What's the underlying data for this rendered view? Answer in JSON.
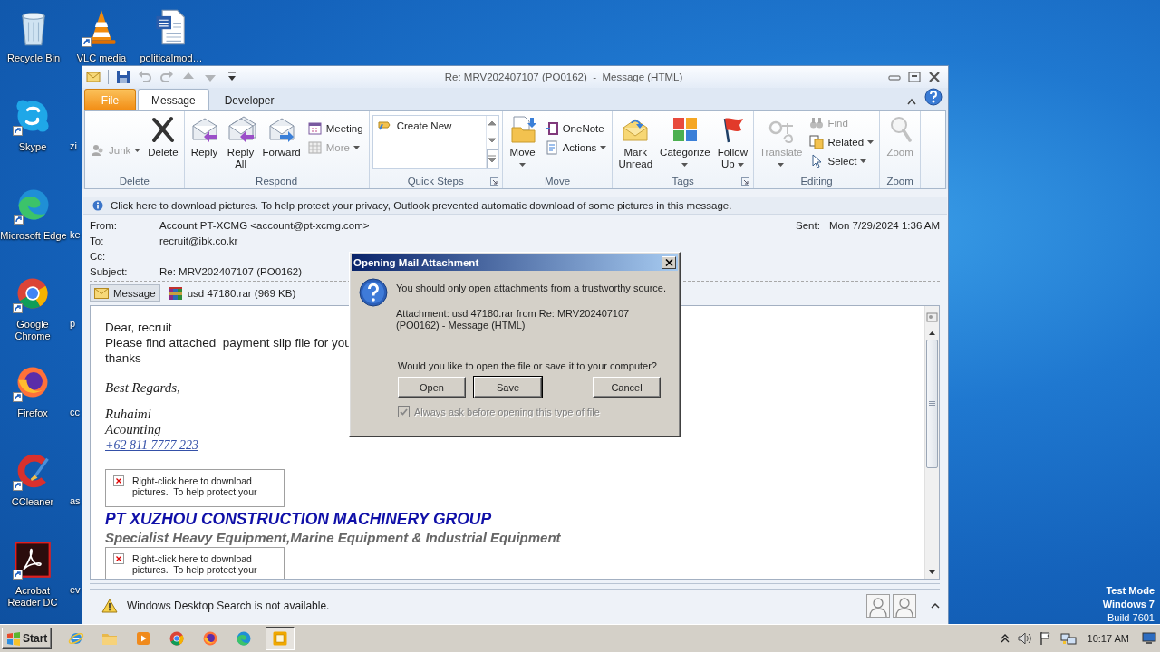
{
  "desktop": {
    "icons": [
      {
        "label": "Recycle Bin",
        "shortcut": false
      },
      {
        "label": "VLC media",
        "shortcut": true
      },
      {
        "label": "politicalmod…",
        "shortcut": false
      },
      {
        "label": "Skype",
        "shortcut": true
      },
      {
        "label": "Microsoft Edge",
        "shortcut": true
      },
      {
        "label": "Google Chrome",
        "shortcut": true
      },
      {
        "label": "Firefox",
        "shortcut": true
      },
      {
        "label": "CCleaner",
        "shortcut": true
      },
      {
        "label": "Acrobat Reader DC",
        "shortcut": true
      }
    ],
    "partial_labels": [
      "zi",
      "ke",
      "p",
      "cc",
      "as",
      "ev"
    ],
    "os_notice": [
      "Test Mode",
      "Windows 7",
      "Build 7601"
    ]
  },
  "window": {
    "title": "Re: MRV202407107 (PO0162)  -  Message (HTML)",
    "quick_access": [
      {
        "disabled": false
      },
      {
        "disabled": true
      },
      {
        "disabled": true
      },
      {
        "disabled": true
      },
      {
        "disabled": true
      },
      {
        "disabled": false
      }
    ],
    "tabs": [
      {
        "label": "File",
        "kind": "backstage",
        "selected": false
      },
      {
        "label": "Message",
        "kind": "tab",
        "selected": true
      },
      {
        "label": "Developer",
        "kind": "tab",
        "selected": false
      }
    ],
    "ribbon": [
      {
        "label": "Delete",
        "launcher": false,
        "items": [
          {
            "kind": "small",
            "label": "Junk",
            "disabled": true,
            "dropdown": true
          },
          {
            "kind": "large",
            "label": "Delete",
            "disabled": false,
            "dropdown": false
          }
        ]
      },
      {
        "label": "Respond",
        "launcher": false,
        "items": [
          {
            "kind": "large",
            "label": "Reply",
            "disabled": false,
            "dropdown": false
          },
          {
            "kind": "large",
            "label": "Reply All",
            "disabled": false,
            "dropdown": false
          },
          {
            "kind": "large",
            "label": "Forward",
            "disabled": false,
            "dropdown": false
          },
          {
            "kind": "small",
            "label": "Meeting",
            "disabled": false,
            "dropdown": false
          },
          {
            "kind": "small",
            "label": "More",
            "disabled": true,
            "dropdown": true
          }
        ]
      },
      {
        "label": "Quick Steps",
        "launcher": true,
        "items": [
          {
            "kind": "gallery",
            "entries": [
              "Create New"
            ]
          }
        ]
      },
      {
        "label": "Move",
        "launcher": false,
        "items": [
          {
            "kind": "large",
            "label": "Move",
            "disabled": false,
            "dropdown": true
          },
          {
            "kind": "small",
            "label": "OneNote",
            "disabled": false,
            "dropdown": false
          },
          {
            "kind": "small",
            "label": "Actions",
            "disabled": false,
            "dropdown": true
          }
        ]
      },
      {
        "label": "Tags",
        "launcher": true,
        "items": [
          {
            "kind": "large",
            "label": "Mark Unread",
            "disabled": false,
            "dropdown": false
          },
          {
            "kind": "large",
            "label": "Categorize",
            "disabled": false,
            "dropdown": true
          },
          {
            "kind": "large",
            "label": "Follow Up",
            "disabled": false,
            "dropdown": true
          }
        ]
      },
      {
        "label": "Editing",
        "launcher": false,
        "items": [
          {
            "kind": "large",
            "label": "Translate",
            "disabled": true,
            "dropdown": true
          },
          {
            "kind": "small",
            "label": "Find",
            "disabled": true,
            "dropdown": false
          },
          {
            "kind": "small",
            "label": "Related",
            "disabled": false,
            "dropdown": true
          },
          {
            "kind": "small",
            "label": "Select",
            "disabled": false,
            "dropdown": true
          }
        ]
      },
      {
        "label": "Zoom",
        "launcher": false,
        "items": [
          {
            "kind": "large",
            "label": "Zoom",
            "disabled": true,
            "dropdown": false
          }
        ]
      }
    ],
    "infobar": "Click here to download pictures. To help protect your privacy, Outlook prevented automatic download of some pictures in this message.",
    "header": {
      "fields": [
        {
          "label": "From:",
          "value": "Account PT-XCMG <account@pt-xcmg.com>"
        },
        {
          "label": "To:",
          "value": "recruit@ibk.co.kr"
        },
        {
          "label": "Cc:"
        },
        {
          "label": "Subject:",
          "value": "Re: MRV202407107 (PO0162)"
        }
      ],
      "sent": {
        "label": "Sent:",
        "value": "Mon 7/29/2024 1:36 AM"
      }
    },
    "attachments": [
      {
        "label": "Message",
        "kind": "message",
        "selected": true
      },
      {
        "label": "usd 47180.rar (969 KB)",
        "kind": "file",
        "selected": false
      }
    ],
    "body": [
      {
        "kind": "plain",
        "text": "Dear, recruit"
      },
      {
        "kind": "plain",
        "text": "Please find attached  payment slip file for you"
      },
      {
        "kind": "plain",
        "text": "thanks"
      },
      {
        "kind": "gap"
      },
      {
        "kind": "signature",
        "text": "Best Regards,"
      },
      {
        "kind": "gap"
      },
      {
        "kind": "signature",
        "text": "Ruhaimi"
      },
      {
        "kind": "signature",
        "text": "Acounting"
      },
      {
        "kind": "link",
        "text": "+62 811  7777 223"
      },
      {
        "kind": "gap"
      },
      {
        "kind": "blocked_image",
        "text": "Right-click here to download pictures.  To help protect your"
      },
      {
        "kind": "company",
        "text": "PT XUZHOU CONSTRUCTION MACHINERY GROUP"
      },
      {
        "kind": "tagline",
        "text": "Specialist Heavy Equipment,Marine Equipment & Industrial Equipment"
      },
      {
        "kind": "blocked_image",
        "text": "Right-click here to download pictures.  To help protect your"
      }
    ],
    "status": "Windows Desktop Search is not available."
  },
  "dialog": {
    "title": "Opening Mail Attachment",
    "message": "You should only open attachments from a trustworthy source.",
    "detail": "Attachment: usd 47180.rar from Re: MRV202407107 (PO0162) - Message (HTML)",
    "question": "Would you like to open the file or save it to your computer?",
    "buttons": [
      {
        "label": "Open",
        "default": false
      },
      {
        "label": "Save",
        "default": true
      },
      {
        "label": "Cancel",
        "default": false
      }
    ],
    "checkbox": {
      "label": "Always ask before opening this type of file",
      "checked": true,
      "disabled": true
    }
  },
  "taskbar": {
    "start": "Start",
    "apps": [
      {
        "active": false
      },
      {
        "active": false
      },
      {
        "active": false
      },
      {
        "active": false
      },
      {
        "active": false
      },
      {
        "active": false
      },
      {
        "active": true
      }
    ],
    "clock": "10:17 AM"
  }
}
